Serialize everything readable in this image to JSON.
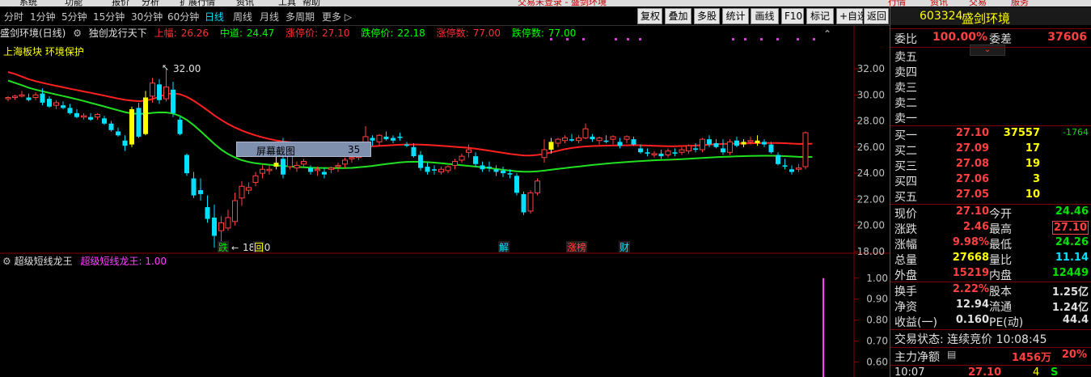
{
  "menu": {
    "items": [
      "系统",
      "功能",
      "报价",
      "分析",
      "扩展行情",
      "资讯",
      "工具",
      "帮助"
    ],
    "title": "交易未登录 - 盛剑环境",
    "right_buttons": [
      "行情",
      "资讯",
      "交易",
      "服务"
    ]
  },
  "periods": [
    "分时",
    "1分钟",
    "5分钟",
    "15分钟",
    "30分钟",
    "60分钟",
    "日线",
    "周线",
    "月线",
    "多周期",
    "更多"
  ],
  "selected_period": "日线",
  "toolbar": [
    "复权",
    "叠加",
    "多股",
    "统计",
    "画线",
    "F10",
    "标记",
    "+自选",
    "返回"
  ],
  "chart_info": {
    "name": "盛剑环境(日线)",
    "indicator": "独创龙行天下",
    "upper_label": "上幅:",
    "upper": "26.26",
    "mid_label": "中道:",
    "mid": "24.47",
    "limit_up_label": "涨停价:",
    "limit_up": "27.10",
    "limit_down_label": "跌停价:",
    "limit_down": "22.18",
    "up_count_label": "涨停数:",
    "up_count": "77.00",
    "down_count_label": "跌停数:",
    "down_count": "77.00"
  },
  "sector_tags": "上海板块   环境保护",
  "screenshot_tip": {
    "label": "屏幕截图",
    "value": "35"
  },
  "indicator2": {
    "name": "超级短线龙王",
    "value_label": "超级短线龙王:",
    "value": "1.00"
  },
  "chart_data": {
    "type": "candlestick",
    "yticks": [
      "32.00",
      "30.00",
      "28.00",
      "26.00",
      "24.00",
      "22.00",
      "20.00",
      "18.00"
    ],
    "ylim": [
      17.5,
      33.3
    ],
    "annotations": {
      "high": "32.00",
      "low": "18.30"
    },
    "event_markers": [
      "跌",
      "回",
      "解",
      "涨榜",
      "财"
    ],
    "candles": [
      [
        29.7,
        29.9,
        29.5,
        29.8
      ],
      [
        29.8,
        30.0,
        29.6,
        29.9
      ],
      [
        29.9,
        30.3,
        29.8,
        30.0
      ],
      [
        29.8,
        30.1,
        29.5,
        29.6
      ],
      [
        29.8,
        30.2,
        29.6,
        30.0
      ],
      [
        30.1,
        30.5,
        29.2,
        29.4
      ],
      [
        29.7,
        29.9,
        29.0,
        29.1
      ],
      [
        29.2,
        29.6,
        28.9,
        29.4
      ],
      [
        29.2,
        29.5,
        28.9,
        29.0
      ],
      [
        29.0,
        29.3,
        28.5,
        28.6
      ],
      [
        28.6,
        28.9,
        28.2,
        28.3
      ],
      [
        28.3,
        28.6,
        28.1,
        28.4
      ],
      [
        28.3,
        28.6,
        28.0,
        28.1
      ],
      [
        28.3,
        28.6,
        28.1,
        28.5
      ],
      [
        28.2,
        28.4,
        27.7,
        27.8
      ],
      [
        27.8,
        28.0,
        27.2,
        27.3
      ],
      [
        27.2,
        27.5,
        26.8,
        26.9
      ],
      [
        26.5,
        26.9,
        25.7,
        26.1
      ],
      [
        26.2,
        29.1,
        26.0,
        28.9
      ],
      [
        29.0,
        29.4,
        26.7,
        26.8
      ],
      [
        27.0,
        30.3,
        26.9,
        29.8
      ],
      [
        29.9,
        31.3,
        29.4,
        30.9
      ],
      [
        30.8,
        31.2,
        29.3,
        29.6
      ],
      [
        29.7,
        32.0,
        29.5,
        30.6
      ],
      [
        30.4,
        31.0,
        28.3,
        28.6
      ],
      [
        28.1,
        28.3,
        26.9,
        27.0
      ],
      [
        25.4,
        25.5,
        23.8,
        24.0
      ],
      [
        23.6,
        24.1,
        22.1,
        22.3
      ],
      [
        22.7,
        23.6,
        21.9,
        22.4
      ],
      [
        21.4,
        22.3,
        20.2,
        20.5
      ],
      [
        20.6,
        21.6,
        18.3,
        19.2
      ],
      [
        19.6,
        20.7,
        18.5,
        20.2
      ],
      [
        19.8,
        21.2,
        19.6,
        20.6
      ],
      [
        20.3,
        22.5,
        20.0,
        21.9
      ],
      [
        22.1,
        23.4,
        21.5,
        23.0
      ],
      [
        22.7,
        23.3,
        22.4,
        22.9
      ],
      [
        23.3,
        24.1,
        23.0,
        23.8
      ],
      [
        24.0,
        24.6,
        23.6,
        24.3
      ],
      [
        24.2,
        24.6,
        23.9,
        24.3
      ],
      [
        24.8,
        25.8,
        24.3,
        24.5
      ],
      [
        25.1,
        26.7,
        23.6,
        23.9
      ],
      [
        24.5,
        25.6,
        24.3,
        25.4
      ],
      [
        24.4,
        24.9,
        24.1,
        24.6
      ],
      [
        24.7,
        25.1,
        24.5,
        24.9
      ],
      [
        24.4,
        24.6,
        23.9,
        24.1
      ],
      [
        24.2,
        24.5,
        23.8,
        24.3
      ],
      [
        24.1,
        24.4,
        23.6,
        23.9
      ],
      [
        24.3,
        24.5,
        24.0,
        24.4
      ],
      [
        24.5,
        24.8,
        24.1,
        24.6
      ],
      [
        24.7,
        25.2,
        24.4,
        25.0
      ],
      [
        25.1,
        25.4,
        24.8,
        25.2
      ],
      [
        25.2,
        26.3,
        25.0,
        26.1
      ],
      [
        26.3,
        27.6,
        25.8,
        26.8
      ],
      [
        26.7,
        26.9,
        26.1,
        26.5
      ],
      [
        26.4,
        27.0,
        26.1,
        26.9
      ],
      [
        26.8,
        27.2,
        26.5,
        26.6
      ],
      [
        26.7,
        26.9,
        26.3,
        26.5
      ],
      [
        26.8,
        27.1,
        26.5,
        26.7
      ],
      [
        26.2,
        26.4,
        26.0,
        26.1
      ],
      [
        26.0,
        26.3,
        25.2,
        25.3
      ],
      [
        25.4,
        25.7,
        24.2,
        24.4
      ],
      [
        24.5,
        24.8,
        23.9,
        24.1
      ],
      [
        24.3,
        24.6,
        23.9,
        24.2
      ],
      [
        24.1,
        24.5,
        23.9,
        24.3
      ],
      [
        24.2,
        24.6,
        24.0,
        24.5
      ],
      [
        24.6,
        25.1,
        24.3,
        24.9
      ],
      [
        25.0,
        25.5,
        24.8,
        25.3
      ],
      [
        25.6,
        26.2,
        25.2,
        25.8
      ],
      [
        25.3,
        25.6,
        24.5,
        24.7
      ],
      [
        24.6,
        24.9,
        24.1,
        24.3
      ],
      [
        24.5,
        24.9,
        24.1,
        24.4
      ],
      [
        24.3,
        24.6,
        23.8,
        24.1
      ],
      [
        24.2,
        24.5,
        23.7,
        24.0
      ],
      [
        24.0,
        24.3,
        23.6,
        23.9
      ],
      [
        23.8,
        24.0,
        22.3,
        22.5
      ],
      [
        22.4,
        22.6,
        20.8,
        21.0
      ],
      [
        21.1,
        22.7,
        20.9,
        22.5
      ],
      [
        22.5,
        23.6,
        22.3,
        23.4
      ],
      [
        25.2,
        26.6,
        24.8,
        25.8
      ],
      [
        25.8,
        26.7,
        25.5,
        26.4
      ],
      [
        26.3,
        26.7,
        26.0,
        26.6
      ],
      [
        26.5,
        26.9,
        26.3,
        26.7
      ],
      [
        26.6,
        27.0,
        26.4,
        26.5
      ],
      [
        26.5,
        26.9,
        26.3,
        26.7
      ],
      [
        26.7,
        27.8,
        26.6,
        27.4
      ],
      [
        26.8,
        27.0,
        26.4,
        26.6
      ],
      [
        26.5,
        26.8,
        26.2,
        26.7
      ],
      [
        26.5,
        26.9,
        26.3,
        26.4
      ],
      [
        26.6,
        26.9,
        26.2,
        26.8
      ],
      [
        26.4,
        26.7,
        25.9,
        26.1
      ],
      [
        26.6,
        26.9,
        26.3,
        26.8
      ],
      [
        26.6,
        26.8,
        26.1,
        26.2
      ],
      [
        25.9,
        26.2,
        25.5,
        25.6
      ],
      [
        25.6,
        25.9,
        25.3,
        25.5
      ],
      [
        25.4,
        25.7,
        25.2,
        25.5
      ],
      [
        25.5,
        25.8,
        25.1,
        25.3
      ],
      [
        25.4,
        25.9,
        25.2,
        25.7
      ],
      [
        25.6,
        25.9,
        25.3,
        25.5
      ],
      [
        25.6,
        26.0,
        25.4,
        25.8
      ],
      [
        25.7,
        26.2,
        25.5,
        26.1
      ],
      [
        25.9,
        26.3,
        25.6,
        25.8
      ],
      [
        25.8,
        26.7,
        25.6,
        26.6
      ],
      [
        26.6,
        26.9,
        26.0,
        26.2
      ],
      [
        26.3,
        26.6,
        25.9,
        26.0
      ],
      [
        25.9,
        26.6,
        25.4,
        25.6
      ],
      [
        25.6,
        26.6,
        25.4,
        26.4
      ],
      [
        26.5,
        26.8,
        26.0,
        26.1
      ],
      [
        26.2,
        26.6,
        26.0,
        26.4
      ],
      [
        26.4,
        26.8,
        26.2,
        26.5
      ],
      [
        26.5,
        26.9,
        26.1,
        26.3
      ],
      [
        26.4,
        26.6,
        26.0,
        26.2
      ],
      [
        26.2,
        26.4,
        25.5,
        25.6
      ],
      [
        25.4,
        25.6,
        24.6,
        24.7
      ],
      [
        24.6,
        25.1,
        24.3,
        24.5
      ],
      [
        24.3,
        24.6,
        23.9,
        24.1
      ],
      [
        24.3,
        24.7,
        24.1,
        24.4
      ],
      [
        24.5,
        27.2,
        24.3,
        27.1
      ]
    ],
    "yellow_bodies": [
      18,
      20,
      39,
      79,
      107,
      109,
      117
    ],
    "upper_line": {
      "name": "上幅",
      "values": [
        31.75,
        31.6,
        31.4,
        31.2,
        31.05,
        30.92,
        30.8,
        30.69,
        30.58,
        30.47,
        30.37,
        30.26,
        30.16,
        30.05,
        29.94,
        29.83,
        29.72,
        29.62,
        29.56,
        29.52,
        29.55,
        29.68,
        29.87,
        30.06,
        30.12,
        30.05,
        29.85,
        29.55,
        29.2,
        28.82,
        28.43,
        28.08,
        27.77,
        27.5,
        27.27,
        27.07,
        26.9,
        26.75,
        26.62,
        26.51,
        26.43,
        26.37,
        26.33,
        26.29,
        26.25,
        26.21,
        26.17,
        26.12,
        26.08,
        26.05,
        26.03,
        26.02,
        26.03,
        26.06,
        26.09,
        26.12,
        26.15,
        26.18,
        26.2,
        26.2,
        26.19,
        26.17,
        26.14,
        26.1,
        26.06,
        26.02,
        25.98,
        25.94,
        25.88,
        25.8,
        25.72,
        25.64,
        25.56,
        25.48,
        25.41,
        25.36,
        25.35,
        25.4,
        25.48,
        25.6,
        25.72,
        25.84,
        25.93,
        26.0,
        26.05,
        26.08,
        26.1,
        26.11,
        26.12,
        26.13,
        26.14,
        26.15,
        26.14,
        26.12,
        26.1,
        26.08,
        26.07,
        26.07,
        26.08,
        26.1,
        26.12,
        26.15,
        26.19,
        26.22,
        26.24,
        26.26,
        26.27,
        26.28,
        26.29,
        26.3,
        26.31,
        26.31,
        26.31,
        26.3,
        26.27,
        26.24,
        26.24,
        26.26
      ]
    },
    "mid_line": {
      "name": "中道",
      "values": [
        31.1,
        30.92,
        30.74,
        30.55,
        30.4,
        30.27,
        30.15,
        30.03,
        29.91,
        29.79,
        29.66,
        29.53,
        29.39,
        29.25,
        29.11,
        28.96,
        28.82,
        28.68,
        28.58,
        28.54,
        28.56,
        28.62,
        28.66,
        28.65,
        28.57,
        28.38,
        28.08,
        27.68,
        27.22,
        26.73,
        26.24,
        25.81,
        25.47,
        25.21,
        25.0,
        24.86,
        24.76,
        24.7,
        24.65,
        24.6,
        24.56,
        24.52,
        24.49,
        24.46,
        24.43,
        24.41,
        24.4,
        24.39,
        24.39,
        24.39,
        24.41,
        24.45,
        24.5,
        24.56,
        24.63,
        24.7,
        24.77,
        24.83,
        24.87,
        24.88,
        24.87,
        24.85,
        24.81,
        24.76,
        24.71,
        24.66,
        24.61,
        24.56,
        24.51,
        24.45,
        24.39,
        24.32,
        24.26,
        24.2,
        24.15,
        24.12,
        24.11,
        24.14,
        24.2,
        24.27,
        24.33,
        24.39,
        24.45,
        24.51,
        24.57,
        24.63,
        24.68,
        24.73,
        24.78,
        24.82,
        24.86,
        24.9,
        24.93,
        24.96,
        24.99,
        25.01,
        25.03,
        25.05,
        25.08,
        25.11,
        25.14,
        25.17,
        25.2,
        25.23,
        25.25,
        25.27,
        25.29,
        25.31,
        25.32,
        25.33,
        25.34,
        25.34,
        25.33,
        25.31,
        25.28,
        25.25,
        25.24,
        25.25
      ]
    }
  },
  "indicator_chart": {
    "yticks": [
      "1.00",
      "0.90",
      "0.80",
      "0.70",
      "0.60"
    ],
    "ylim": [
      0.56,
      1.03
    ],
    "signal_value": 1.0
  },
  "quote": {
    "code": "603324",
    "name": "盛剑环境",
    "wb_label": "委比",
    "wb": "100.00%",
    "wc_label": "委差",
    "wc": "37606",
    "sells": [
      {
        "label": "卖五"
      },
      {
        "label": "卖四"
      },
      {
        "label": "卖三"
      },
      {
        "label": "卖二"
      },
      {
        "label": "卖一"
      }
    ],
    "buys": [
      {
        "label": "买一",
        "price": "27.10",
        "vol": "37557",
        "chg": "-1764"
      },
      {
        "label": "买二",
        "price": "27.09",
        "vol": "17"
      },
      {
        "label": "买三",
        "price": "27.08",
        "vol": "19"
      },
      {
        "label": "买四",
        "price": "27.06",
        "vol": "3"
      },
      {
        "label": "买五",
        "price": "27.05",
        "vol": "10"
      }
    ],
    "stats": [
      {
        "l1": "现价",
        "v1": "27.10",
        "l2": "今开",
        "v2": "24.46"
      },
      {
        "l1": "涨跌",
        "v1": "2.46",
        "l2": "最高",
        "v2": "27.10"
      },
      {
        "l1": "涨幅",
        "v1": "9.98%",
        "l2": "最低",
        "v2": "24.26"
      },
      {
        "l1": "总量",
        "v1": "27668",
        "l2": "量比",
        "v2": "11.14"
      },
      {
        "l1": "外盘",
        "v1": "15219",
        "l2": "内盘",
        "v2": "12449"
      },
      {
        "l1": "换手",
        "v1": "2.22%",
        "l2": "股本",
        "v2": "1.25亿"
      },
      {
        "l1": "净资",
        "v1": "12.94",
        "l2": "流通",
        "v2": "1.24亿"
      },
      {
        "l1": "收益(一)",
        "v1": "0.160",
        "l2": "PE(动)",
        "v2": "44.4"
      }
    ],
    "trade_status": "交易状态: 连续竞价 10:08:45",
    "main_net_label": "主力净额",
    "main_net": "1456万",
    "main_pct": "20%",
    "tick": {
      "time": "10:07",
      "price": "27.10",
      "vol": "4",
      "side": "S"
    }
  }
}
